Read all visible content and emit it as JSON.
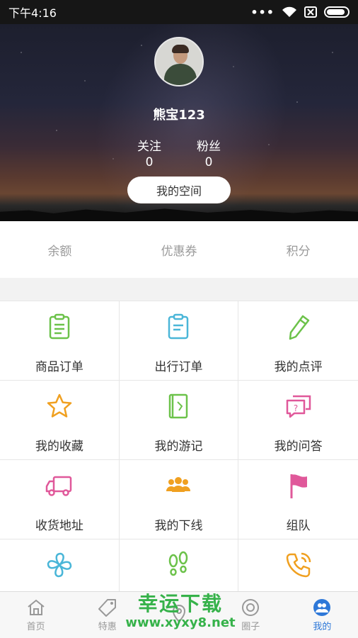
{
  "status_bar": {
    "time": "下午4:16",
    "dots": "•••"
  },
  "profile": {
    "username": "熊宝123",
    "follow_label": "关注",
    "follow_count": "0",
    "fans_label": "粉丝",
    "fans_count": "0",
    "space_button": "我的空间"
  },
  "wallet": [
    {
      "label": "余额"
    },
    {
      "label": "优惠券"
    },
    {
      "label": "积分"
    }
  ],
  "grid": [
    {
      "label": "商品订单",
      "icon": "clipboard-icon",
      "color": "#6cc24a"
    },
    {
      "label": "出行订单",
      "icon": "clipboard-icon",
      "color": "#4ab6d8"
    },
    {
      "label": "我的点评",
      "icon": "pencil-icon",
      "color": "#6cc24a"
    },
    {
      "label": "我的收藏",
      "icon": "star-icon",
      "color": "#f0a020"
    },
    {
      "label": "我的游记",
      "icon": "book-icon",
      "color": "#6cc24a"
    },
    {
      "label": "我的问答",
      "icon": "question-icon",
      "color": "#e0589a"
    },
    {
      "label": "收货地址",
      "icon": "truck-icon",
      "color": "#e0589a"
    },
    {
      "label": "我的下线",
      "icon": "group-icon",
      "color": "#f0a020"
    },
    {
      "label": "组队",
      "icon": "flag-icon",
      "color": "#e0589a"
    },
    {
      "label": "",
      "icon": "fan-icon",
      "color": "#4ab6d8"
    },
    {
      "label": "",
      "icon": "footprints-icon",
      "color": "#6cc24a"
    },
    {
      "label": "",
      "icon": "phone-icon",
      "color": "#f0a020"
    }
  ],
  "tabs": [
    {
      "label": "首页"
    },
    {
      "label": "特惠"
    },
    {
      "label": ""
    },
    {
      "label": "圈子"
    },
    {
      "label": "我的"
    }
  ],
  "watermark": {
    "title": "幸运下载",
    "url": "www.xyxy8.net"
  }
}
